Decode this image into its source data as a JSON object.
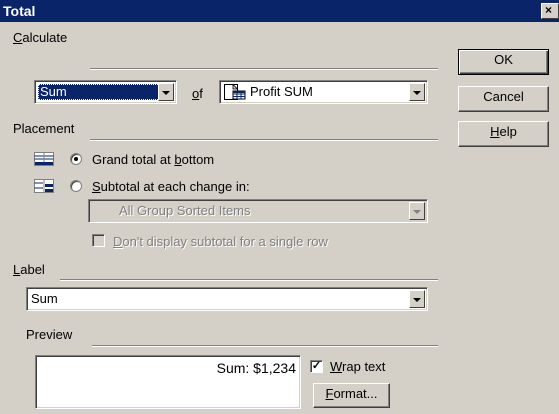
{
  "window": {
    "title": "Total",
    "close_glyph": "×"
  },
  "calculate": {
    "heading_prefix": "",
    "heading_mnemonic": "C",
    "heading_rest": "alculate",
    "function_value": "Sum",
    "of_mnemonic": "o",
    "of_rest": "f",
    "column_value": "Profit SUM",
    "column_icon": "table-column-icon"
  },
  "placement": {
    "heading": "Placement",
    "grand_total": {
      "label_prefix": "Grand total at ",
      "label_mnemonic": "b",
      "label_rest": "ottom",
      "selected": true,
      "icon": "grand-total-layout-icon"
    },
    "subtotal": {
      "label_prefix": "",
      "label_mnemonic": "S",
      "label_rest": "ubtotal at each change in:",
      "selected": false,
      "icon": "subtotal-layout-icon"
    },
    "group_select_value": "All Group Sorted Items",
    "single_row_option": {
      "label_mnemonic": "D",
      "label_rest": "on't display subtotal for a single row",
      "checked": false,
      "enabled": false
    }
  },
  "label_section": {
    "heading_mnemonic": "L",
    "heading_rest": "abel",
    "value": "Sum"
  },
  "preview": {
    "heading": "Preview",
    "text": "Sum: $1,234",
    "wrap_mnemonic": "W",
    "wrap_rest": "rap text",
    "wrap_checked": true,
    "format_mnemonic": "F",
    "format_rest": "ormat..."
  },
  "buttons": {
    "ok": "OK",
    "cancel": "Cancel",
    "help_mnemonic": "H",
    "help_rest": "elp"
  },
  "colors": {
    "title_bar": "#0a246a",
    "face": "#d4d0c8",
    "selection": "#0a246a"
  }
}
